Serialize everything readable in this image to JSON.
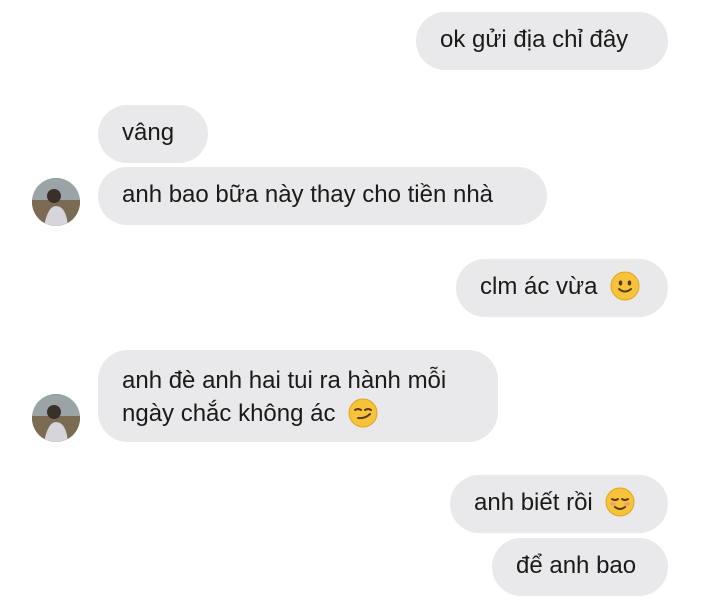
{
  "conversation": {
    "messages": [
      {
        "sender": "me",
        "text": "ok gửi địa chỉ đây"
      },
      {
        "sender": "them",
        "text": "vâng"
      },
      {
        "sender": "them",
        "text": "anh bao bữa này thay cho tiền nhà"
      },
      {
        "sender": "me",
        "text": "clm ác vừa",
        "emoji": "slightly-smiling-face"
      },
      {
        "sender": "them",
        "line1": "anh đè anh hai tui ra hành mỗi",
        "line2": "ngày chắc không ác",
        "emoji": "smirking-face"
      },
      {
        "sender": "me",
        "text": "anh biết rồi",
        "emoji": "smiling-face"
      },
      {
        "sender": "me",
        "text": "để anh bao"
      }
    ]
  },
  "colors": {
    "bubble": "#e9e9eb",
    "text": "#1a1a1a",
    "emoji": "#f7c33b"
  }
}
